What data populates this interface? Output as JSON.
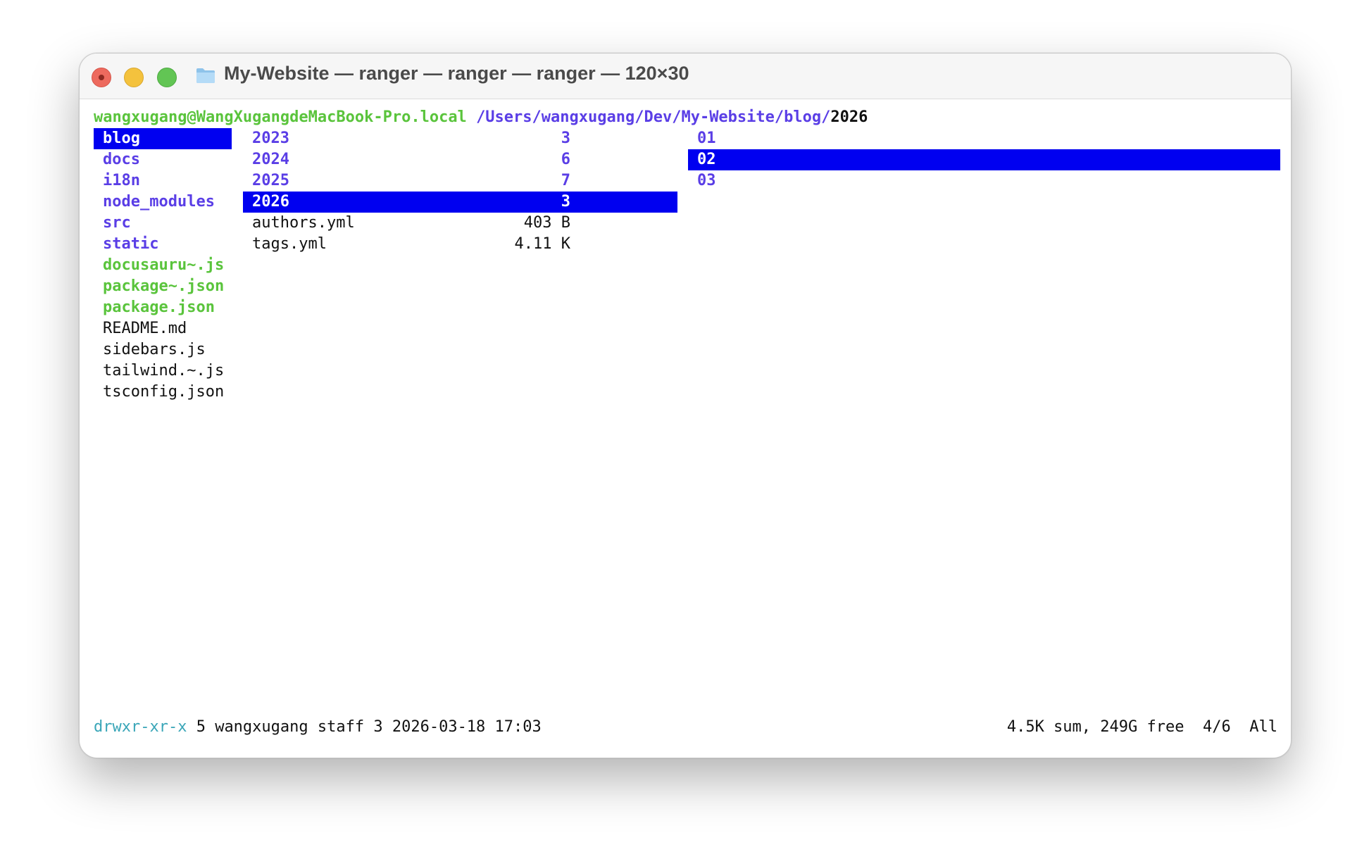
{
  "window": {
    "title": "My-Website — ranger — ranger — ranger — 120×30"
  },
  "prompt": {
    "user_host": "wangxugang@WangXugangdeMacBook-Pro.local",
    "path": "/Users/wangxugang/Dev/My-Website/blog/",
    "current": "2026"
  },
  "parent_column": [
    {
      "name": "blog",
      "type": "dir",
      "selected": true
    },
    {
      "name": "docs",
      "type": "dir"
    },
    {
      "name": "i18n",
      "type": "dir"
    },
    {
      "name": "node_modules",
      "type": "dir"
    },
    {
      "name": "src",
      "type": "dir"
    },
    {
      "name": "static",
      "type": "dir"
    },
    {
      "name": "docusauru~.js",
      "type": "exec"
    },
    {
      "name": "package~.json",
      "type": "exec"
    },
    {
      "name": "package.json",
      "type": "exec"
    },
    {
      "name": "README.md",
      "type": "file"
    },
    {
      "name": "sidebars.js",
      "type": "file"
    },
    {
      "name": "tailwind.~.js",
      "type": "file"
    },
    {
      "name": "tsconfig.json",
      "type": "file"
    }
  ],
  "main_column": [
    {
      "name": "2023",
      "info": "3",
      "type": "dir"
    },
    {
      "name": "2024",
      "info": "6",
      "type": "dir"
    },
    {
      "name": "2025",
      "info": "7",
      "type": "dir"
    },
    {
      "name": "2026",
      "info": "3",
      "type": "dir",
      "selected": true
    },
    {
      "name": "authors.yml",
      "info": "403 B",
      "type": "file"
    },
    {
      "name": "tags.yml",
      "info": "4.11 K",
      "type": "file"
    }
  ],
  "preview_column": [
    {
      "name": "01",
      "type": "dir"
    },
    {
      "name": "02",
      "type": "dir",
      "selected": true
    },
    {
      "name": "03",
      "type": "dir"
    }
  ],
  "status": {
    "permissions": "drwxr-xr-x",
    "details": "5 wangxugang staff 3 2026-03-18 17:03",
    "summary": "4.5K sum, 249G free",
    "position": "4/6",
    "scroll": "All"
  },
  "colors": {
    "selection": "#0000f0",
    "directory": "#5a3ee6",
    "executable": "#5ac43c",
    "permissions": "#3aa6b8"
  },
  "icons": [
    "folder-icon"
  ]
}
